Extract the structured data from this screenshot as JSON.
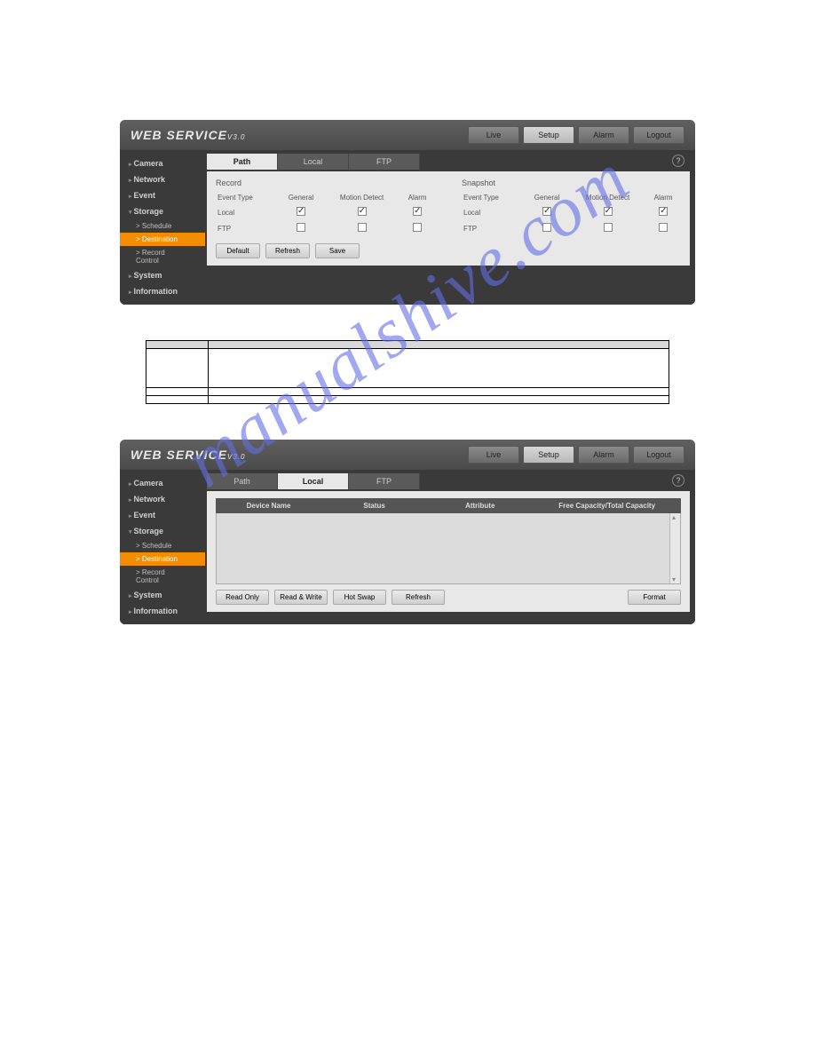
{
  "logo": {
    "main": "WEB  SERVICE",
    "ver": "V3.0"
  },
  "topbtns": {
    "live": "Live",
    "setup": "Setup",
    "alarm": "Alarm",
    "logout": "Logout"
  },
  "sidebar": {
    "camera": "Camera",
    "network": "Network",
    "event": "Event",
    "storage": "Storage",
    "schedule": "Schedule",
    "destination": "Destination",
    "recordctrl": "Record Control",
    "system": "System",
    "info": "Information"
  },
  "tabs": {
    "path": "Path",
    "local": "Local",
    "ftp": "FTP"
  },
  "help": "?",
  "record": {
    "title": "Record",
    "hdr": {
      "et": "Event Type",
      "gen": "General",
      "md": "Motion Detect",
      "al": "Alarm"
    },
    "rows": {
      "local": "Local",
      "ftp": "FTP"
    }
  },
  "snapshot": {
    "title": "Snapshot"
  },
  "btns": {
    "default": "Default",
    "refresh": "Refresh",
    "save": "Save",
    "readonly": "Read Only",
    "readwrite": "Read & Write",
    "hotswap": "Hot Swap",
    "format": "Format"
  },
  "localtable": {
    "devname": "Device Name",
    "status": "Status",
    "attr": "Attribute",
    "cap": "Free Capacity/Total Capacity"
  },
  "ptable": {
    "h1": "",
    "h2": "",
    "r1c1": "",
    "r1c2": "",
    "r2c1": "",
    "r2c2": "",
    "r3c1": "",
    "r3c2": ""
  }
}
